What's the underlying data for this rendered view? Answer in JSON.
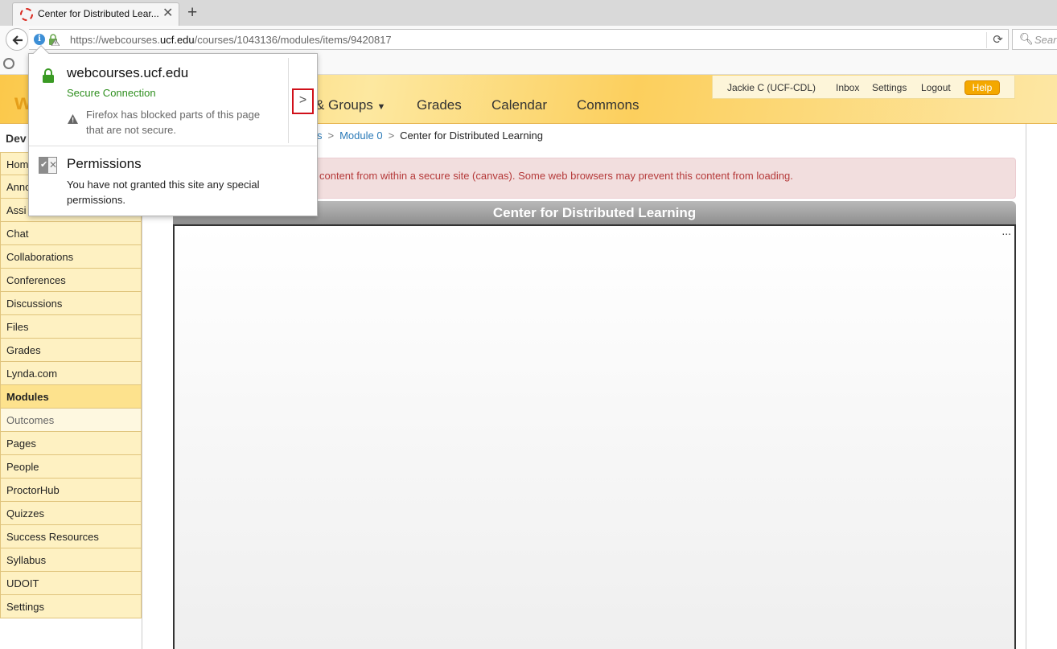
{
  "browser": {
    "tab_title": "Center for Distributed Lear...",
    "url_prefix": "https://webcourses.",
    "url_domain": "ucf.edu",
    "url_suffix": "/courses/1043136/modules/items/9420817",
    "search_placeholder": "Search"
  },
  "header": {
    "logo": "w",
    "nav": [
      "& Groups",
      "Grades",
      "Calendar",
      "Commons"
    ],
    "user": "Jackie C (UCF-CDL)",
    "inbox": "Inbox",
    "settings": "Settings",
    "logout": "Logout",
    "help": "Help"
  },
  "sidebar": {
    "course_title": "Dev",
    "items": [
      {
        "label": "Hom"
      },
      {
        "label": "Anno"
      },
      {
        "label": "Assi"
      },
      {
        "label": "Chat"
      },
      {
        "label": "Collaborations"
      },
      {
        "label": "Conferences"
      },
      {
        "label": "Discussions"
      },
      {
        "label": "Files"
      },
      {
        "label": "Grades"
      },
      {
        "label": "Lynda.com"
      },
      {
        "label": "Modules"
      },
      {
        "label": "Outcomes"
      },
      {
        "label": "Pages"
      },
      {
        "label": "People"
      },
      {
        "label": "ProctorHub"
      },
      {
        "label": "Quizzes"
      },
      {
        "label": "Success Resources"
      },
      {
        "label": "Syllabus"
      },
      {
        "label": "UDOIT"
      },
      {
        "label": "Settings"
      }
    ]
  },
  "breadcrumb": {
    "item1": "s",
    "item2": "Module 0",
    "current": "Center for Distributed Learning",
    "separator": ">"
  },
  "alert": {
    "text": "content from within a secure site (canvas). Some web browsers may prevent this content from loading."
  },
  "frame": {
    "title": "Center for Distributed Learning",
    "menu": "..."
  },
  "popup": {
    "host": "webcourses.ucf.edu",
    "secure": "Secure Connection",
    "warning": "Firefox has blocked parts of this page that are not secure.",
    "more": ">",
    "permissions_title": "Permissions",
    "permissions_text": "You have not granted this site any special permissions."
  }
}
